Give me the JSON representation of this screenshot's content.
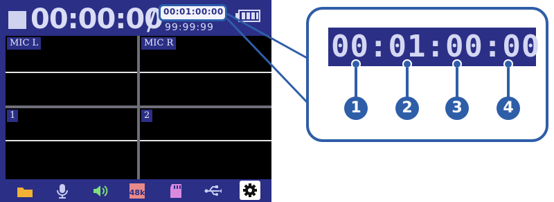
{
  "header": {
    "elapsed_time": "00:00:00",
    "separator": "/",
    "remaining_time": "99:99:99",
    "highlighted_time": "00:01:00:00"
  },
  "channels": [
    {
      "label": "MIC L"
    },
    {
      "label": "MIC R"
    },
    {
      "label": "1"
    },
    {
      "label": "2"
    }
  ],
  "bottom_bar": {
    "icons": [
      "folder-icon",
      "microphone-icon",
      "speaker-icon",
      "sample-rate-icon",
      "sd-card-icon",
      "usb-icon",
      "settings-icon"
    ],
    "sample_rate_label": "48k"
  },
  "callout": {
    "timecode": "00:01:00:00",
    "markers": [
      "1",
      "2",
      "3",
      "4"
    ]
  },
  "colors": {
    "screen_bg": "#2b2f86",
    "accent": "#2f5ea8",
    "text_light": "#d9dcf4"
  }
}
